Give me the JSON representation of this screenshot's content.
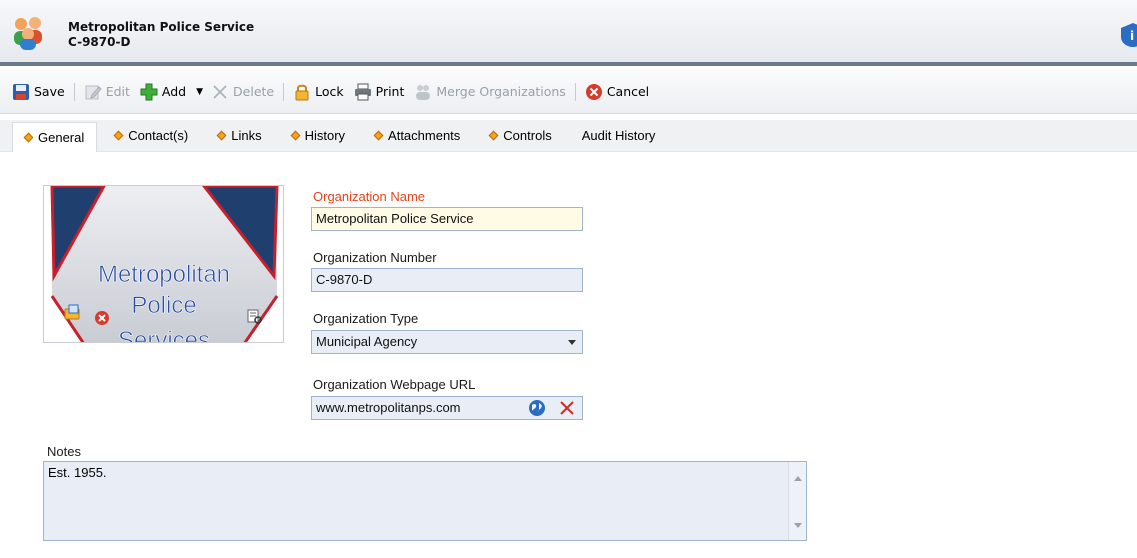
{
  "header": {
    "title": "Metropolitan Police Service",
    "subtitle": "C-9870-D"
  },
  "toolbar": {
    "save": "Save",
    "edit": "Edit",
    "add": "Add",
    "delete": "Delete",
    "lock": "Lock",
    "print": "Print",
    "merge": "Merge Organizations",
    "cancel": "Cancel"
  },
  "tabs": [
    {
      "label": "General",
      "active": true
    },
    {
      "label": "Contact(s)"
    },
    {
      "label": "Links"
    },
    {
      "label": "History"
    },
    {
      "label": "Attachments"
    },
    {
      "label": "Controls"
    },
    {
      "label": "Audit History"
    }
  ],
  "logo": {
    "line1": "Metropolitan",
    "line2": "Police",
    "line3": "Services"
  },
  "form": {
    "org_name_label": "Organization Name",
    "org_name_value": "Metropolitan Police Service",
    "org_number_label": "Organization Number",
    "org_number_value": "C-9870-D",
    "org_type_label": "Organization Type",
    "org_type_value": "Municipal Agency",
    "org_url_label": "Organization Webpage URL",
    "org_url_value": "www.metropolitanps.com",
    "notes_label": "Notes",
    "notes_value": "Est. 1955."
  },
  "colors": {
    "required_label": "#e8431a",
    "field_border": "#9fb4cf",
    "header_rule": "#6d7a8c"
  }
}
